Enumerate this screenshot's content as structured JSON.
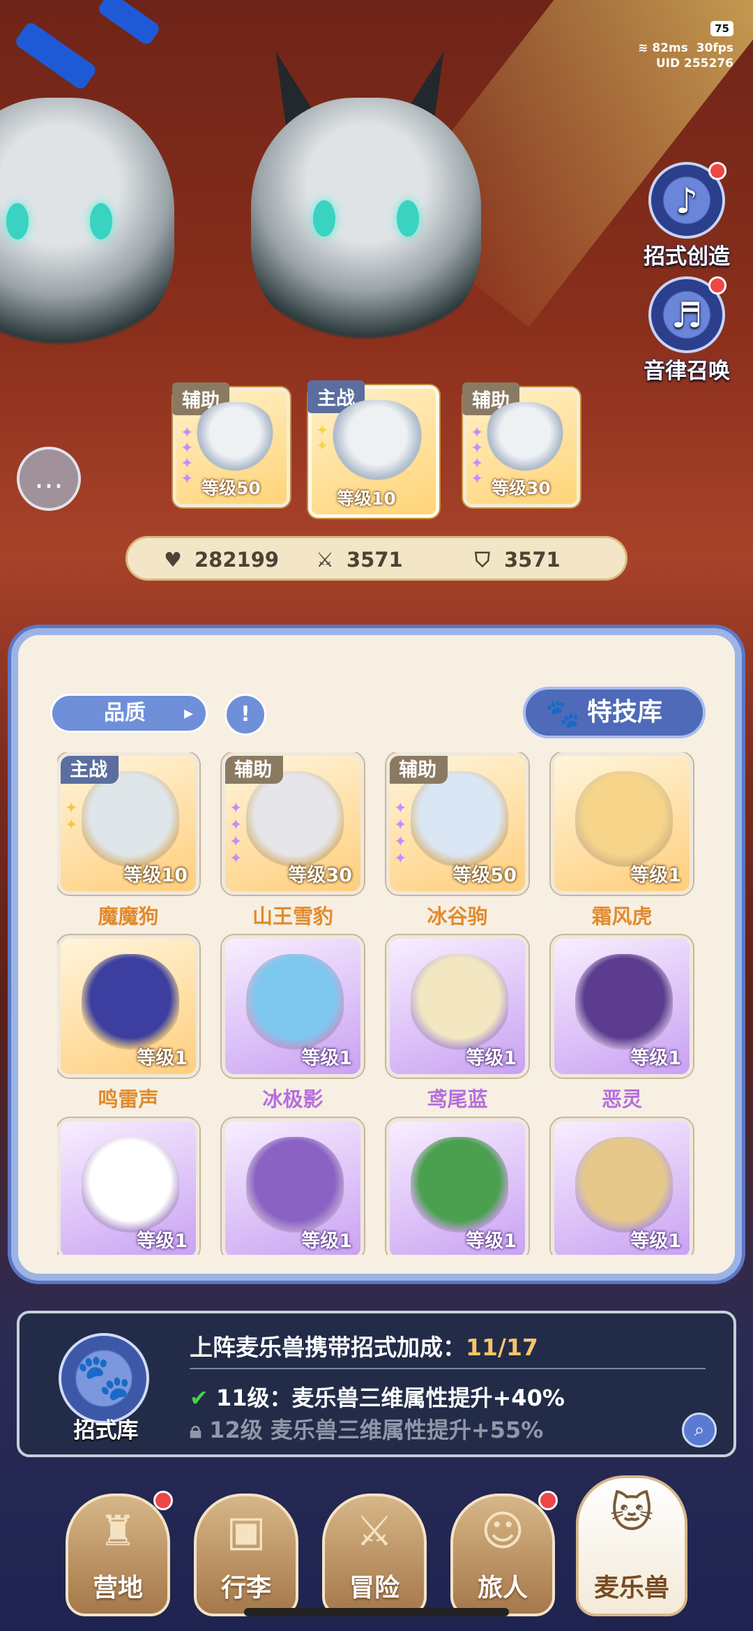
{
  "status": {
    "battery": "75",
    "ping": "82ms",
    "fps": "30fps",
    "uid": "UID 255276"
  },
  "side_buttons": [
    {
      "label": "招式创造",
      "icon": "piano-creature-icon"
    },
    {
      "label": "音律召唤",
      "icon": "lyre-icon"
    }
  ],
  "team": [
    {
      "tag": "辅助",
      "level": "等级50"
    },
    {
      "tag": "主战",
      "level": "等级10"
    },
    {
      "tag": "辅助",
      "level": "等级30"
    }
  ],
  "stats": {
    "hp": "282199",
    "attack": "3571",
    "defense": "3571"
  },
  "filter": {
    "quality_label": "品质",
    "info_glyph": "!",
    "skill_library_label": "特技库"
  },
  "pets": [
    {
      "name": "魔魔狗",
      "level": "等级10",
      "tag": "主战",
      "rarity": "orange",
      "stars": "✦✦"
    },
    {
      "name": "山王雪豹",
      "level": "等级30",
      "tag": "辅助",
      "rarity": "orange",
      "stars": "✦✦✦✦"
    },
    {
      "name": "冰谷驹",
      "level": "等级50",
      "tag": "辅助",
      "rarity": "orange",
      "stars": "✦✦✦✦"
    },
    {
      "name": "霜风虎",
      "level": "等级1",
      "tag": "",
      "rarity": "orange",
      "stars": ""
    },
    {
      "name": "鸣雷声",
      "level": "等级1",
      "tag": "",
      "rarity": "orange",
      "stars": ""
    },
    {
      "name": "冰极影",
      "level": "等级1",
      "tag": "",
      "rarity": "purple",
      "stars": ""
    },
    {
      "name": "鸢尾蓝",
      "level": "等级1",
      "tag": "",
      "rarity": "purple",
      "stars": ""
    },
    {
      "name": "恶灵",
      "level": "等级1",
      "tag": "",
      "rarity": "purple",
      "stars": ""
    },
    {
      "name": "",
      "level": "等级1",
      "tag": "",
      "rarity": "purple",
      "stars": ""
    },
    {
      "name": "",
      "level": "等级1",
      "tag": "",
      "rarity": "purple",
      "stars": ""
    },
    {
      "name": "",
      "level": "等级1",
      "tag": "",
      "rarity": "purple",
      "stars": ""
    },
    {
      "name": "",
      "level": "等级1",
      "tag": "",
      "rarity": "purple",
      "stars": ""
    }
  ],
  "bonus": {
    "icon_label": "招式库",
    "title": "上阵麦乐兽携带招式加成：",
    "count": "11/17",
    "row1": "11级：麦乐兽三维属性提升+40%",
    "row2": "12级  麦乐兽三维属性提升+55%"
  },
  "nav": [
    {
      "label": "营地",
      "icon": "castle-icon",
      "dot": true
    },
    {
      "label": "行李",
      "icon": "backpack-icon",
      "dot": false
    },
    {
      "label": "冒险",
      "icon": "crossed-swords-icon",
      "dot": false
    },
    {
      "label": "旅人",
      "icon": "traveler-icon",
      "dot": true
    },
    {
      "label": "麦乐兽",
      "icon": "cat-icon",
      "dot": false,
      "active": true
    }
  ],
  "colors": {
    "orange_name": "#e28a2c",
    "purple_name": "#b66ee0",
    "accent_blue": "#4e6ab8",
    "count_gold": "#f4c66a"
  }
}
